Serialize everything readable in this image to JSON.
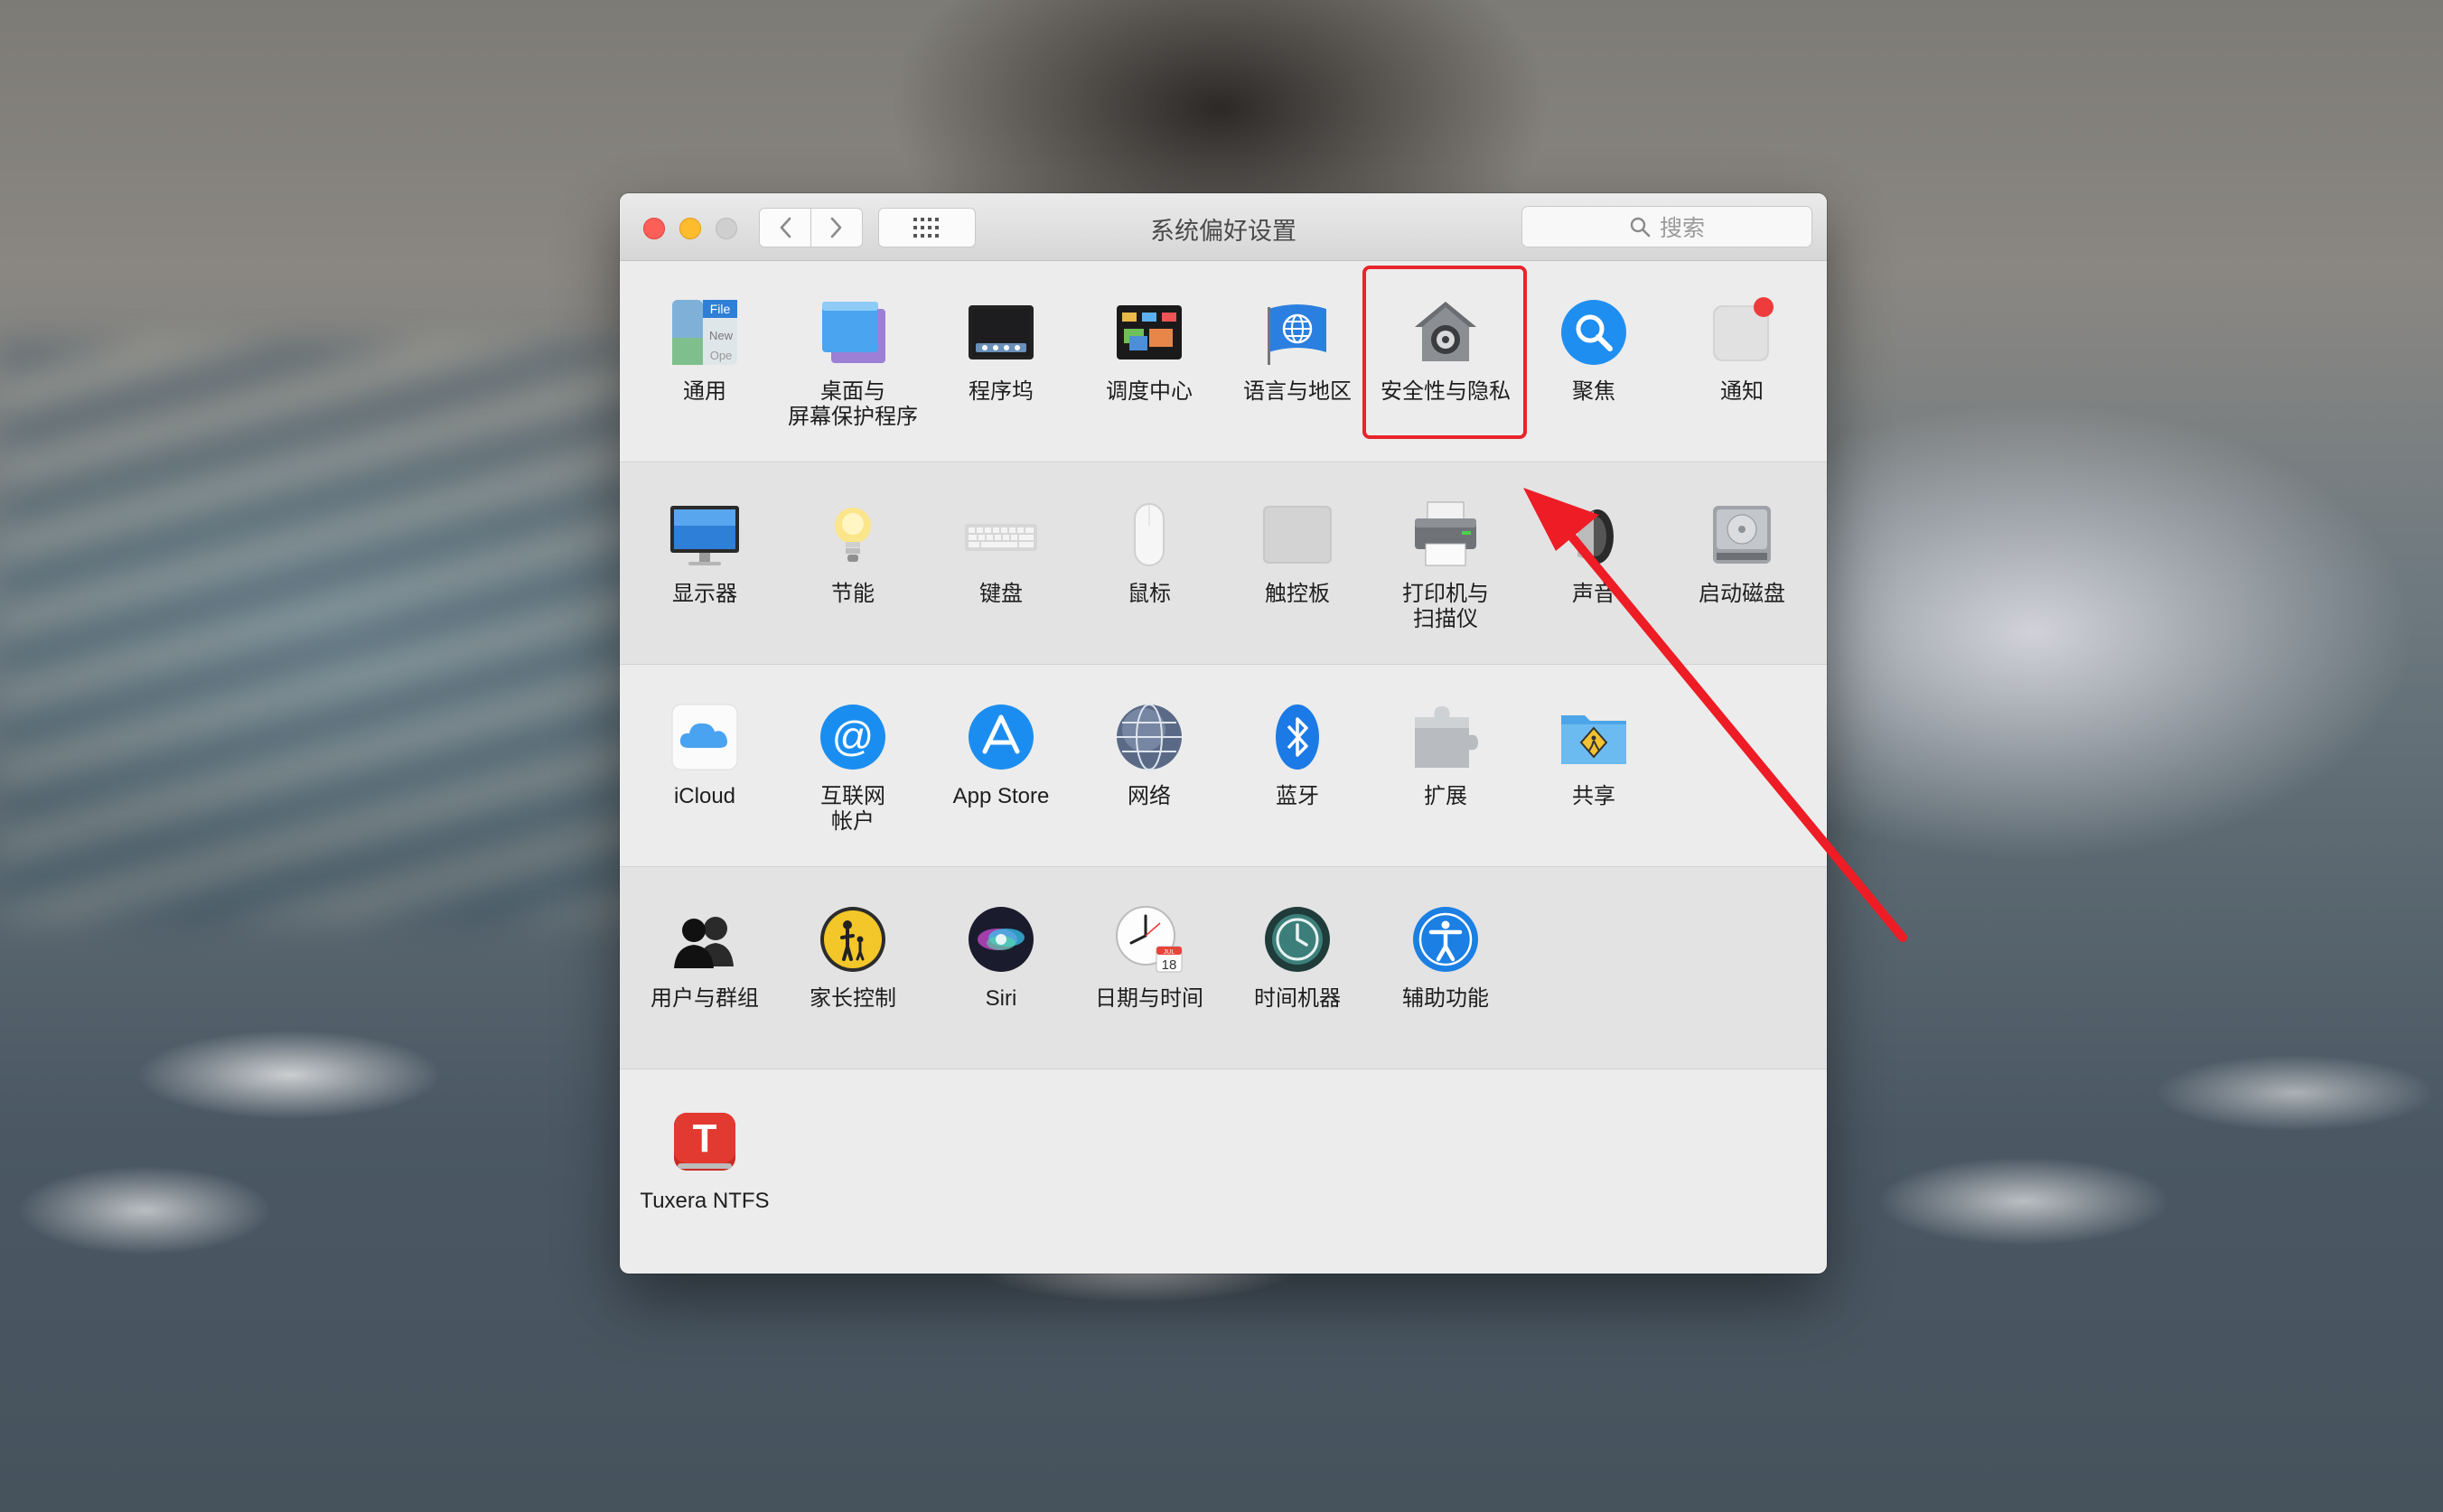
{
  "window": {
    "title": "系统偏好设置",
    "search_placeholder": "搜索"
  },
  "sections": [
    {
      "items": [
        {
          "id": "general",
          "label": "通用",
          "icon": "general-icon"
        },
        {
          "id": "desktop",
          "label": "桌面与\n屏幕保护程序",
          "icon": "desktop-screensaver-icon"
        },
        {
          "id": "dock",
          "label": "程序坞",
          "icon": "dock-icon"
        },
        {
          "id": "mission",
          "label": "调度中心",
          "icon": "mission-control-icon"
        },
        {
          "id": "language",
          "label": "语言与地区",
          "icon": "language-region-icon"
        },
        {
          "id": "security",
          "label": "安全性与隐私",
          "icon": "security-privacy-icon"
        },
        {
          "id": "spotlight",
          "label": "聚焦",
          "icon": "spotlight-icon"
        },
        {
          "id": "notifications",
          "label": "通知",
          "icon": "notifications-icon"
        }
      ]
    },
    {
      "items": [
        {
          "id": "displays",
          "label": "显示器",
          "icon": "displays-icon"
        },
        {
          "id": "energy",
          "label": "节能",
          "icon": "energy-saver-icon"
        },
        {
          "id": "keyboard",
          "label": "键盘",
          "icon": "keyboard-icon"
        },
        {
          "id": "mouse",
          "label": "鼠标",
          "icon": "mouse-icon"
        },
        {
          "id": "trackpad",
          "label": "触控板",
          "icon": "trackpad-icon"
        },
        {
          "id": "printers",
          "label": "打印机与\n扫描仪",
          "icon": "printers-scanners-icon"
        },
        {
          "id": "sound",
          "label": "声音",
          "icon": "sound-icon"
        },
        {
          "id": "startup",
          "label": "启动磁盘",
          "icon": "startup-disk-icon"
        }
      ]
    },
    {
      "items": [
        {
          "id": "icloud",
          "label": "iCloud",
          "icon": "icloud-icon"
        },
        {
          "id": "internet",
          "label": "互联网\n帐户",
          "icon": "internet-accounts-icon"
        },
        {
          "id": "appstore",
          "label": "App Store",
          "icon": "app-store-icon"
        },
        {
          "id": "network",
          "label": "网络",
          "icon": "network-icon"
        },
        {
          "id": "bluetooth",
          "label": "蓝牙",
          "icon": "bluetooth-icon"
        },
        {
          "id": "extensions",
          "label": "扩展",
          "icon": "extensions-icon"
        },
        {
          "id": "sharing",
          "label": "共享",
          "icon": "sharing-icon"
        }
      ]
    },
    {
      "items": [
        {
          "id": "users",
          "label": "用户与群组",
          "icon": "users-groups-icon"
        },
        {
          "id": "parental",
          "label": "家长控制",
          "icon": "parental-controls-icon"
        },
        {
          "id": "siri",
          "label": "Siri",
          "icon": "siri-icon"
        },
        {
          "id": "datetime",
          "label": "日期与时间",
          "icon": "date-time-icon"
        },
        {
          "id": "timemachine",
          "label": "时间机器",
          "icon": "time-machine-icon"
        },
        {
          "id": "accessibility",
          "label": "辅助功能",
          "icon": "accessibility-icon"
        }
      ]
    },
    {
      "items": [
        {
          "id": "tuxera",
          "label": "Tuxera NTFS",
          "icon": "tuxera-ntfs-icon"
        }
      ]
    }
  ],
  "icon_text": {
    "general_file": "File",
    "general_new": "New",
    "general_open": "Ope",
    "tuxera_letter": "T",
    "calendar_month": "JUL",
    "calendar_day": "18",
    "app_store_glyph": "A",
    "at_glyph": "@",
    "bluetooth_glyph": "ᛒ"
  },
  "annotation": {
    "highlighted_item": "安全性与隐私",
    "highlight_color": "#e8242c",
    "arrow_color": "#ee1c25"
  },
  "colors": {
    "window_bg": "#ececec",
    "alt_row_bg": "#e3e3e3",
    "close": "#fc5f57",
    "minimize": "#fdbc2e",
    "zoom_disabled": "#cfcfcf"
  }
}
